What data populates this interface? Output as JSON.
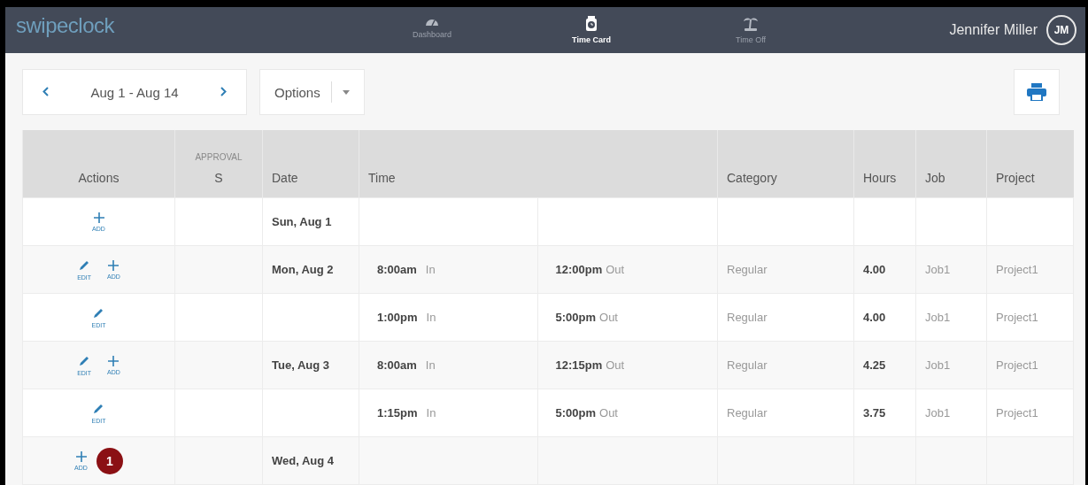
{
  "nav": {
    "logo": "swipeclock",
    "items": [
      {
        "label": "Dashboard",
        "kind": "dashboard",
        "selected": false
      },
      {
        "label": "Time Card",
        "kind": "timecard",
        "selected": true
      },
      {
        "label": "Time Off",
        "kind": "timeoff",
        "selected": false
      }
    ],
    "user": {
      "name": "Jennifer Miller",
      "initials": "JM"
    }
  },
  "toolbar": {
    "range": "Aug 1 - Aug 14",
    "options": "Options"
  },
  "table": {
    "columns": [
      {
        "label": "Actions"
      },
      {
        "label": "S",
        "overline": "APPROVAL"
      },
      {
        "label": "Date"
      },
      {
        "label": "Time"
      },
      {
        "label": "Category"
      },
      {
        "label": "Hours"
      },
      {
        "label": "Job"
      },
      {
        "label": "Project"
      }
    ],
    "rows": [
      {
        "actions": [
          {
            "kind": "add",
            "label": "ADD"
          }
        ],
        "date": "Sun, Aug 1"
      },
      {
        "actions": [
          {
            "kind": "edit",
            "label": "EDIT"
          },
          {
            "kind": "add",
            "label": "ADD"
          }
        ],
        "date": "Mon, Aug 2",
        "in": {
          "time": "8:00am",
          "tag": "In"
        },
        "out": {
          "time": "12:00pm",
          "tag": "Out"
        },
        "category": "Regular",
        "hours": "4.00",
        "job": "Job1",
        "project": "Project1"
      },
      {
        "actions": [
          {
            "kind": "edit",
            "label": "EDIT"
          }
        ],
        "in": {
          "time": "1:00pm",
          "tag": "In"
        },
        "out": {
          "time": "5:00pm",
          "tag": "Out"
        },
        "category": "Regular",
        "hours": "4.00",
        "job": "Job1",
        "project": "Project1"
      },
      {
        "actions": [
          {
            "kind": "edit",
            "label": "EDIT"
          },
          {
            "kind": "add",
            "label": "ADD"
          }
        ],
        "date": "Tue, Aug 3",
        "in": {
          "time": "8:00am",
          "tag": "In"
        },
        "out": {
          "time": "12:15pm",
          "tag": "Out"
        },
        "category": "Regular",
        "hours": "4.25",
        "job": "Job1",
        "project": "Project1"
      },
      {
        "actions": [
          {
            "kind": "edit",
            "label": "EDIT"
          }
        ],
        "in": {
          "time": "1:15pm",
          "tag": "In"
        },
        "out": {
          "time": "5:00pm",
          "tag": "Out"
        },
        "category": "Regular",
        "hours": "3.75",
        "job": "Job1",
        "project": "Project1"
      },
      {
        "actions": [
          {
            "kind": "add",
            "label": "ADD"
          }
        ],
        "badge": "1",
        "date": "Wed, Aug 4"
      }
    ]
  }
}
